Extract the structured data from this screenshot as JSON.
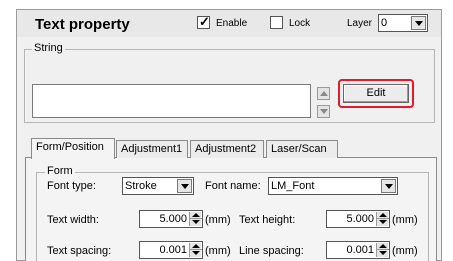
{
  "header": {
    "title": "Text property",
    "enable_label": "Enable",
    "enable_checked": true,
    "lock_label": "Lock",
    "lock_checked": false,
    "layer_label": "Layer",
    "layer_value": "0"
  },
  "string_group": {
    "title": "String",
    "text_value": "",
    "edit_label": "Edit"
  },
  "tabs": [
    {
      "label": "Form/Position",
      "active": true
    },
    {
      "label": "Adjustment1",
      "active": false
    },
    {
      "label": "Adjustment2",
      "active": false
    },
    {
      "label": "Laser/Scan",
      "active": false
    }
  ],
  "form": {
    "title": "Form",
    "font_type_label": "Font type:",
    "font_type_value": "Stroke",
    "font_name_label": "Font name:",
    "font_name_value": "LM_Font",
    "text_width_label": "Text width:",
    "text_width_value": "5.000",
    "text_width_unit": "(mm)",
    "text_height_label": "Text height:",
    "text_height_value": "5.000",
    "text_height_unit": "(mm)",
    "text_spacing_label": "Text spacing:",
    "text_spacing_value": "0.001",
    "text_spacing_unit": "(mm)",
    "line_spacing_label": "Line spacing:",
    "line_spacing_value": "0.001",
    "line_spacing_unit": "(mm)"
  },
  "colors": {
    "highlight": "#e21a2c",
    "panel_bg": "#f0f0f0"
  }
}
